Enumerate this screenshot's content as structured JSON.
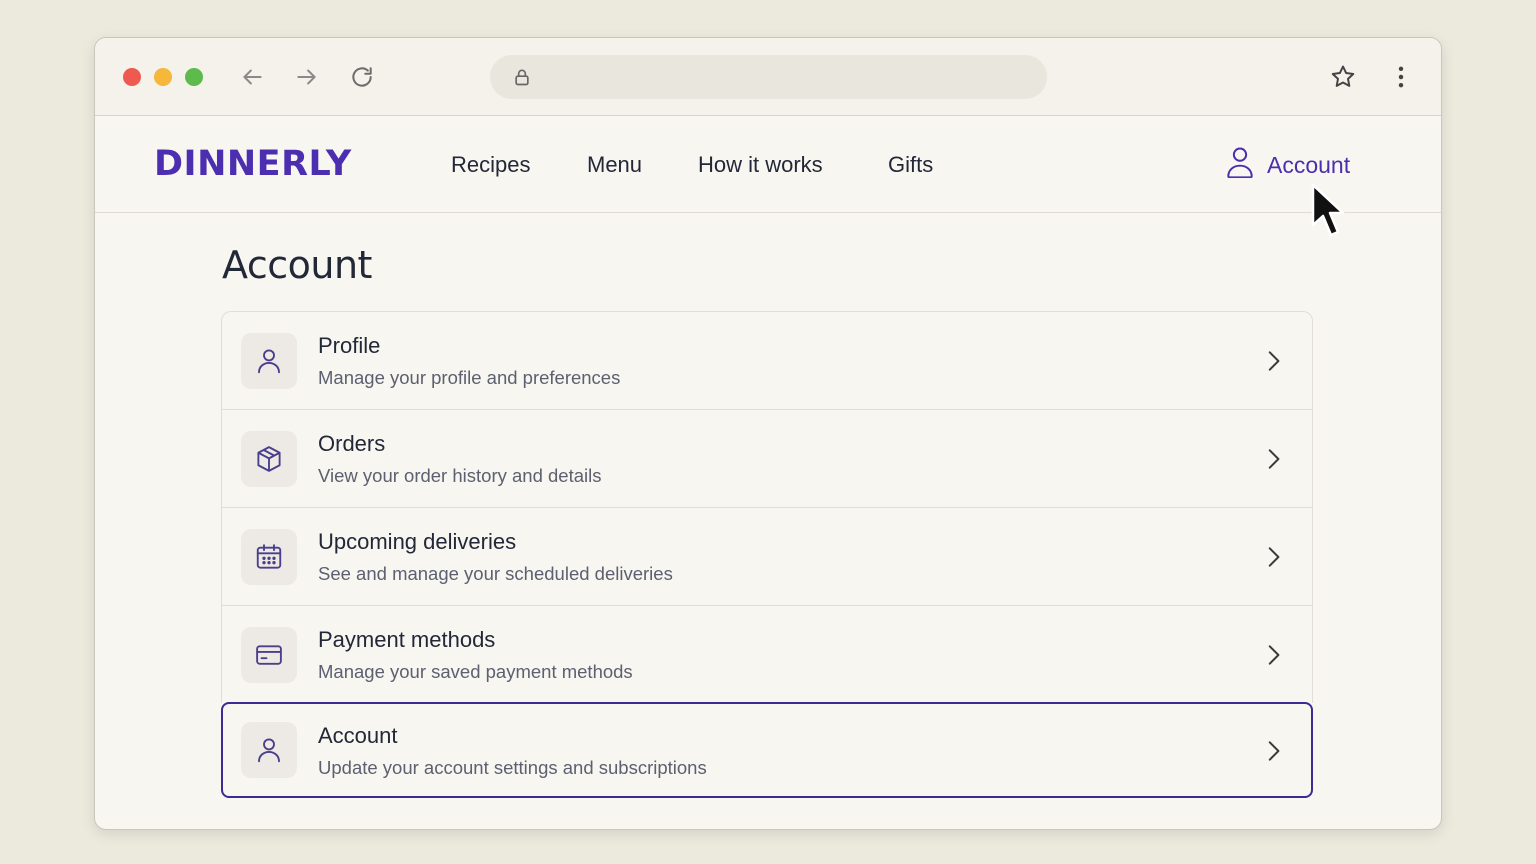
{
  "browser": {
    "back_icon": "arrow-left-icon",
    "forward_icon": "arrow-right-icon",
    "reload_icon": "reload-icon",
    "address_icon": "lock-icon",
    "address_value": "",
    "bookmark_icon": "star-icon",
    "menu_icon": "kebab-menu-icon"
  },
  "header": {
    "logo": "DINNERLY",
    "nav": [
      "Recipes",
      "Menu",
      "How it works",
      "Gifts"
    ],
    "account_label": "Account",
    "account_icon": "user-icon"
  },
  "page": {
    "title": "Account",
    "items": [
      {
        "icon": "user-icon",
        "title": "Profile",
        "description": "Manage your profile and preferences"
      },
      {
        "icon": "box-icon",
        "title": "Orders",
        "description": "View your order history and details"
      },
      {
        "icon": "calendar-icon",
        "title": "Upcoming deliveries",
        "description": "See and manage your scheduled deliveries"
      },
      {
        "icon": "credit-card-icon",
        "title": "Payment methods",
        "description": "Manage your saved payment methods"
      },
      {
        "icon": "user-icon",
        "title": "Account",
        "description": "Update your account settings and subscriptions",
        "selected": true
      }
    ]
  },
  "colors": {
    "brand": "#4c2fb0",
    "selected_border": "#3d2a94",
    "text": "#232838",
    "muted_text": "#5c6070",
    "background": "#ece9dd"
  }
}
